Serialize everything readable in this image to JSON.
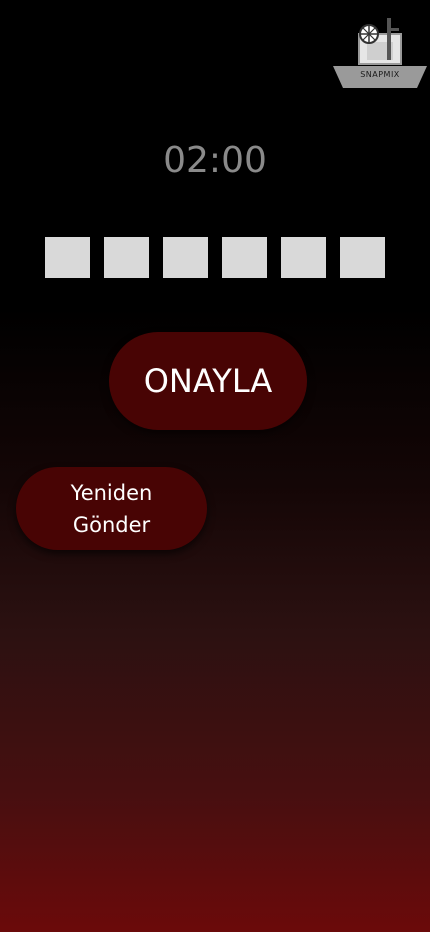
{
  "brand": {
    "logo_text": "SNAPMIX"
  },
  "timer": {
    "value": "02:00"
  },
  "code": {
    "length": 6,
    "values": [
      "",
      "",
      "",
      "",
      "",
      ""
    ]
  },
  "actions": {
    "confirm_label": "ONAYLA",
    "resend_label": "Yeniden Gönder"
  },
  "colors": {
    "button_bg": "#480404",
    "code_box_bg": "#d9d9d9",
    "timer_text": "#8a8a8a",
    "gradient_bottom": "#6b0a0a"
  }
}
